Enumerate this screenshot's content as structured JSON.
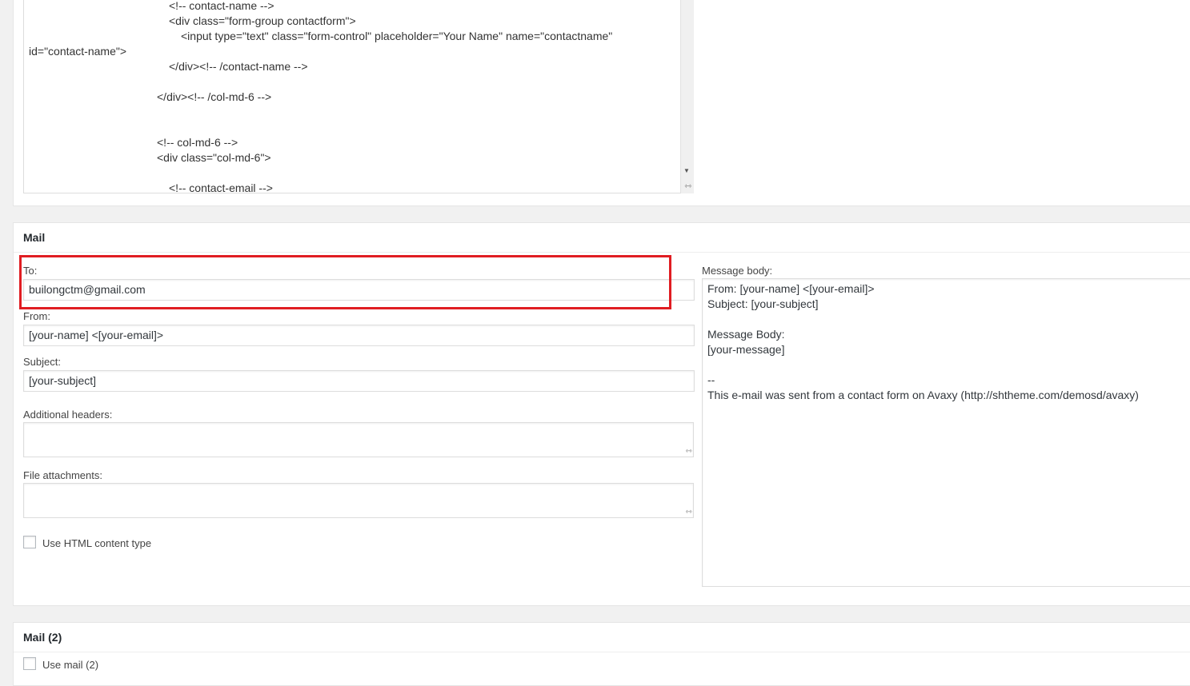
{
  "form_editor": {
    "lines": [
      {
        "indent": 0,
        "text": "<!-- contact-name -->"
      },
      {
        "indent": 1,
        "text": "<div class=\"form-group contactform\">"
      },
      {
        "indent": 2,
        "text": "<input type=\"text\" class=\"form-control\" placeholder=\"Your Name\" name=\"contactname\""
      },
      {
        "indent": 3,
        "text": "id=\"contact-name\">"
      },
      {
        "indent": 4,
        "text": "</div><!-- /contact-name -->"
      },
      {
        "indent": 5,
        "text": "</div><!-- /col-md-6 -->"
      },
      {
        "indent": 6,
        "text": "<!-- col-md-6 -->"
      },
      {
        "indent": 7,
        "text": "<div class=\"col-md-6\">"
      },
      {
        "indent": 8,
        "text": "<!-- contact-email -->"
      }
    ]
  },
  "mail": {
    "title": "Mail",
    "to_label": "To:",
    "to_value": "builongctm@gmail.com",
    "from_label": "From:",
    "from_value": "[your-name] <[your-email]>",
    "subject_label": "Subject:",
    "subject_value": "[your-subject]",
    "additional_headers_label": "Additional headers:",
    "file_attachments_label": "File attachments:",
    "use_html_label": "Use HTML content type",
    "message_body_label": "Message body:",
    "message_body_lines": [
      "From: [your-name] <[your-email]>",
      "Subject: [your-subject]",
      "",
      "Message Body:",
      "[your-message]",
      "",
      "--",
      "This e-mail was sent from a contact form on Avaxy (http://shtheme.com/demosd/avaxy)"
    ]
  },
  "mail2": {
    "title": "Mail (2)",
    "use_mail2_label": "Use mail (2)"
  },
  "colors": {
    "highlight": "#e01d22",
    "panel_bg": "#ffffff",
    "page_bg": "#f1f1f1"
  },
  "icons": {
    "scroll_down": "scroll-down-arrow-icon",
    "resize": "resize-handle-icon"
  }
}
